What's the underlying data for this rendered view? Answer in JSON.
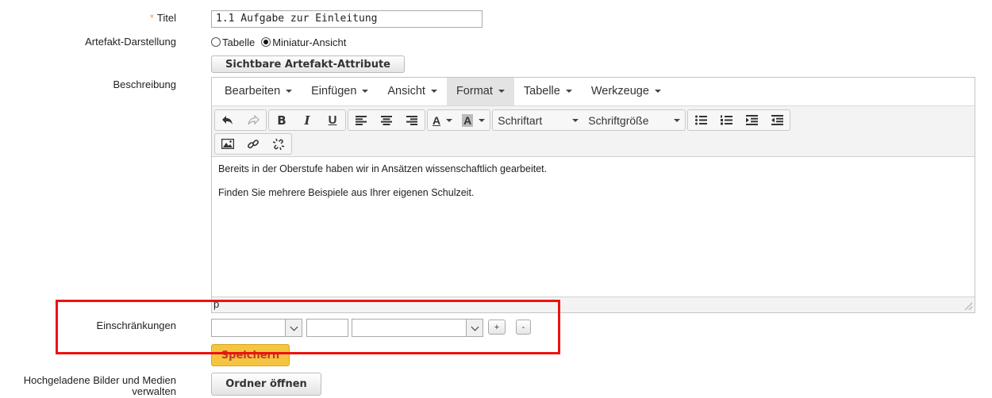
{
  "form": {
    "title_label": "Titel",
    "required_mark": "*",
    "title_value": "1.1 Aufgabe zur Einleitung",
    "display_label": "Artefakt-Darstellung",
    "display_options": [
      "Tabelle",
      "Miniatur-Ansicht"
    ],
    "display_selected": "Miniatur-Ansicht",
    "attributes_button": "Sichtbare Artefakt-Attribute",
    "description_label": "Beschreibung",
    "restrictions_label": "Einschränkungen",
    "plus_label": "+",
    "minus_label": "-",
    "save_button": "Speichern",
    "media_label_line1": "Hochgeladene Bilder und Medien",
    "media_label_line2": "verwalten",
    "open_folder_button": "Ordner öffnen"
  },
  "editor": {
    "menus": [
      "Bearbeiten",
      "Einfügen",
      "Ansicht",
      "Format",
      "Tabelle",
      "Werkzeuge"
    ],
    "active_menu": "Format",
    "bold": "B",
    "italic": "I",
    "underline": "U",
    "text_color": "A",
    "bg_color": "A",
    "font_family": "Schriftart",
    "font_size": "Schriftgröße",
    "paragraphs": [
      "Bereits in der Oberstufe haben wir in Ansätzen wissenschaftlich gearbeitet.",
      "Finden Sie mehrere Beispiele aus Ihrer eigenen Schulzeit."
    ],
    "status_path": "p"
  },
  "colors": {
    "required": "#e8a33d",
    "save_button": "#f5c542",
    "highlight": "#ee1111"
  }
}
